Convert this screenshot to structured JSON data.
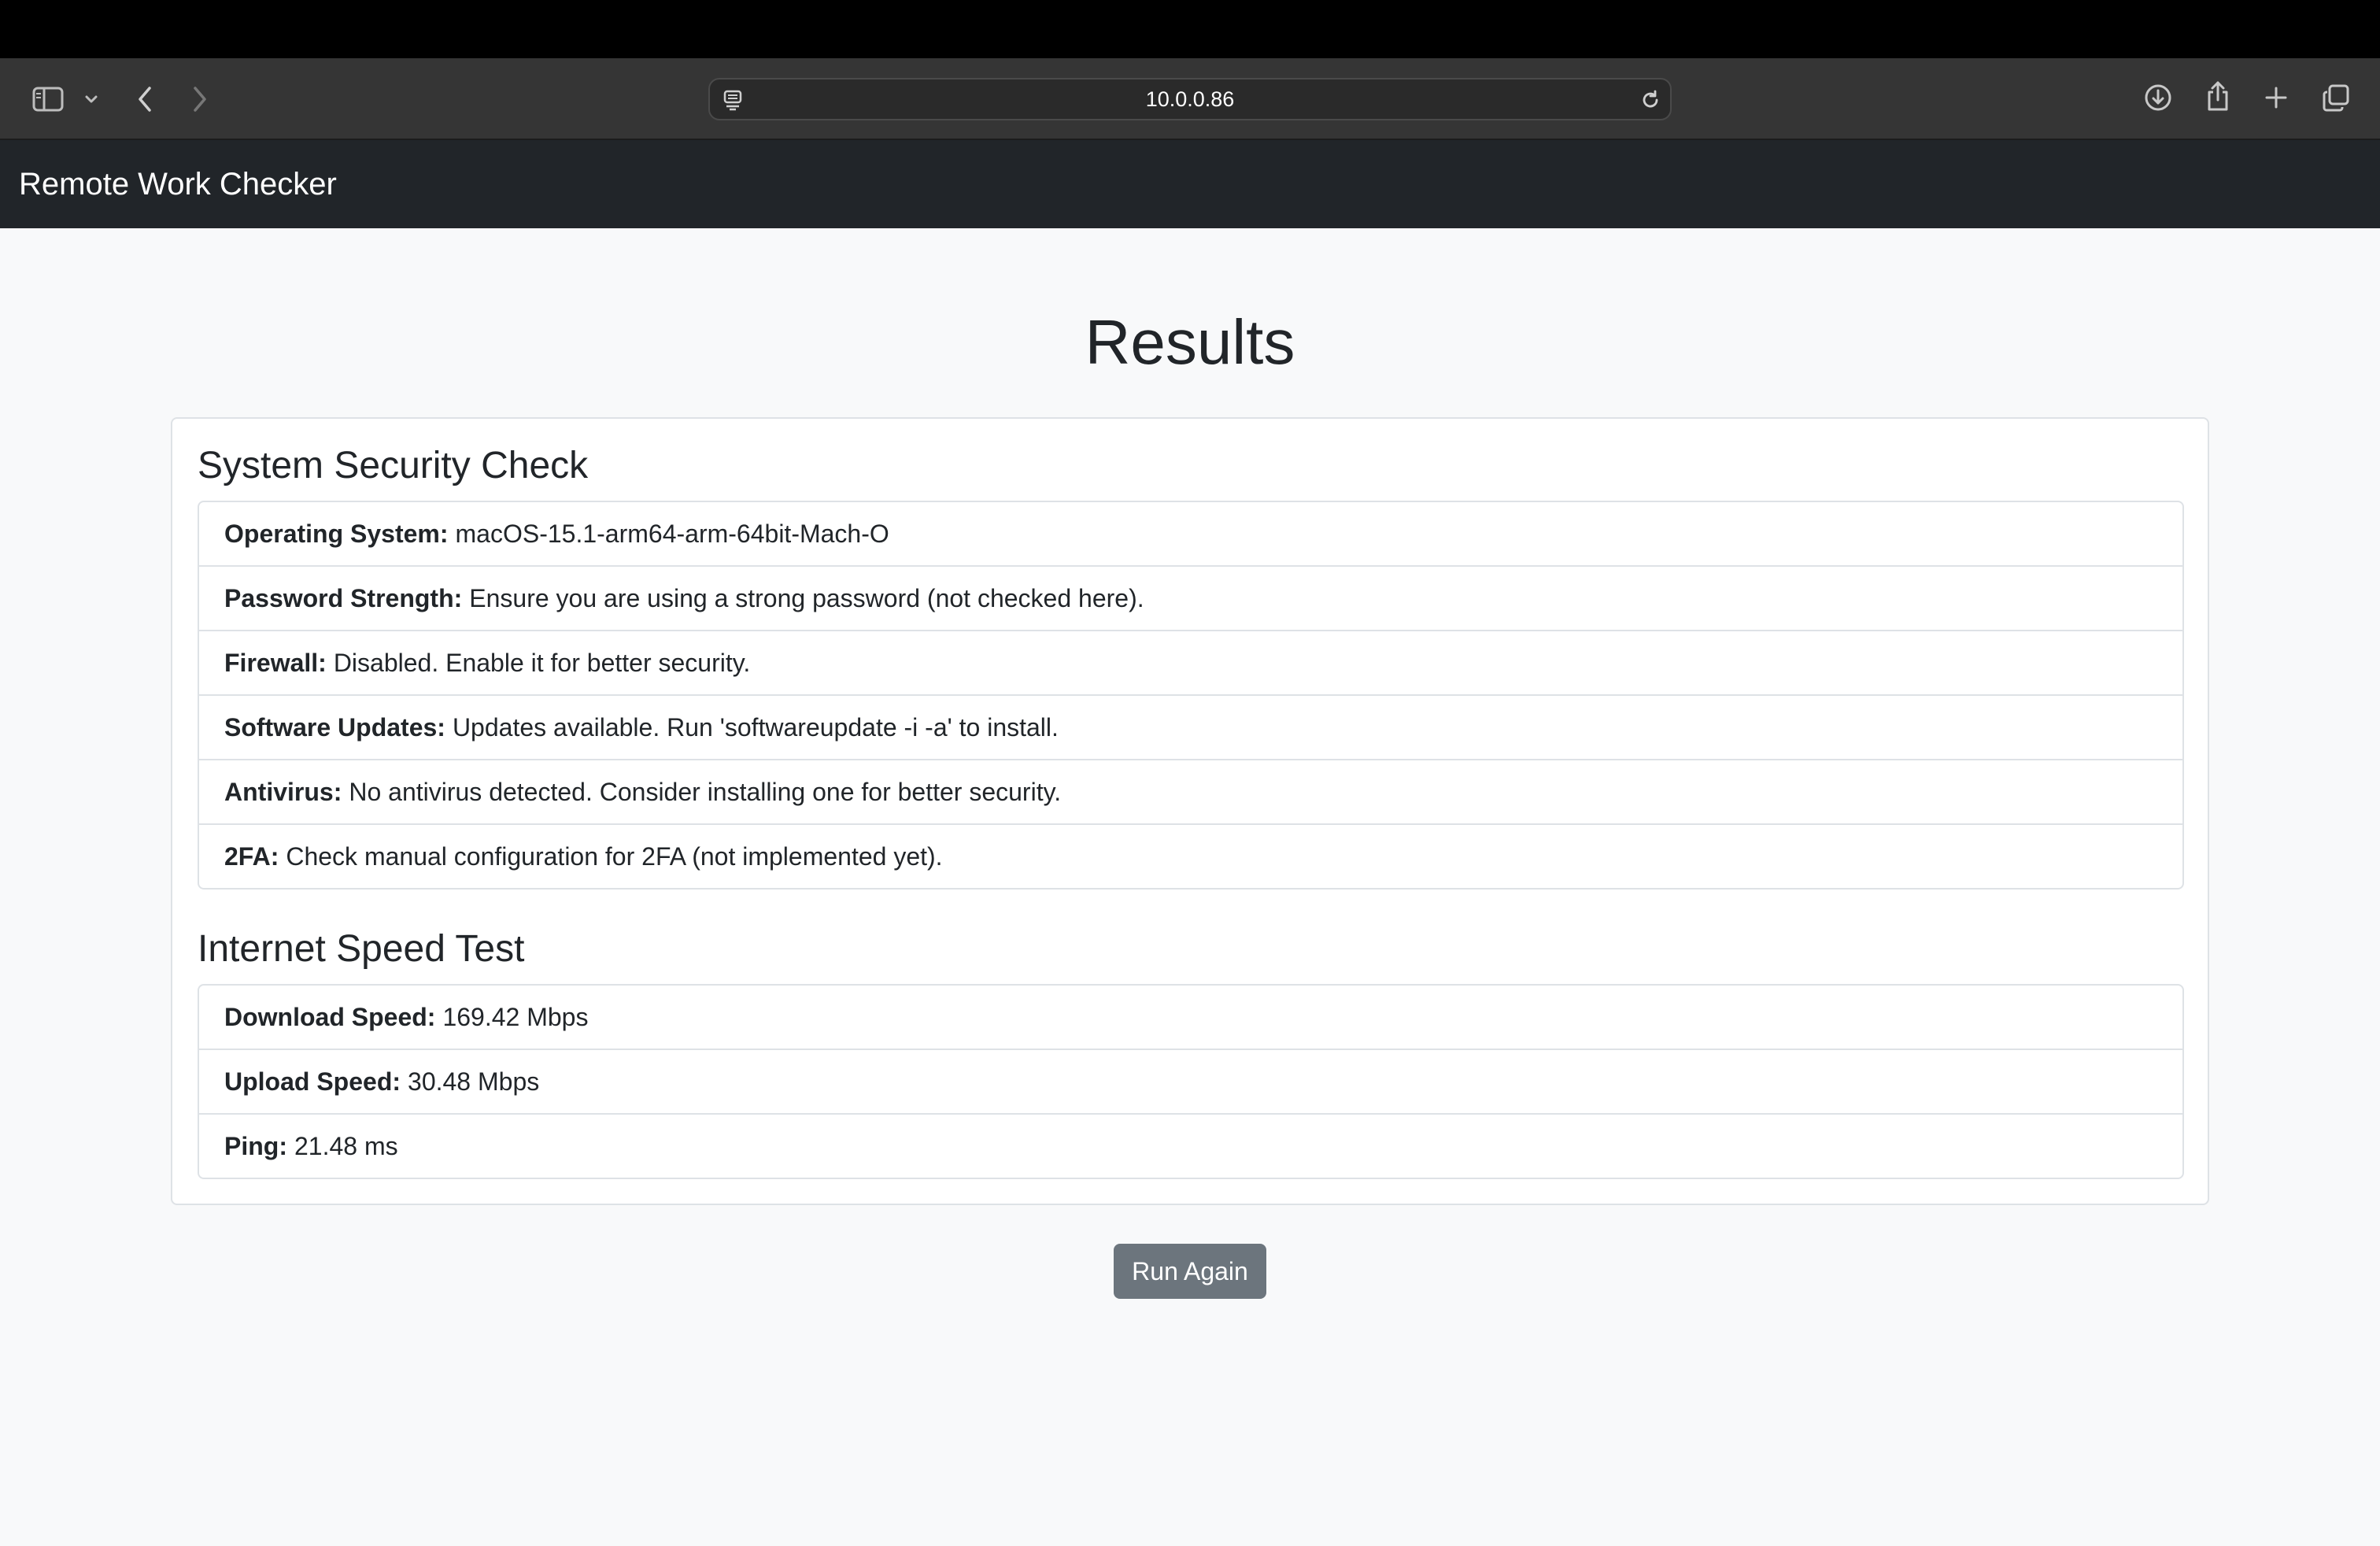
{
  "browser": {
    "url": "10.0.0.86",
    "icons": {
      "sidebar": "sidebar-icon",
      "tabs_menu": "chevron-down-icon",
      "back": "back-arrow-icon",
      "forward": "forward-arrow-icon",
      "page_settings": "page-settings-icon",
      "reload": "reload-icon",
      "downloads": "download-icon",
      "share": "share-icon",
      "new_tab": "plus-icon",
      "tab_overview": "tab-overview-icon"
    }
  },
  "navbar": {
    "brand": "Remote Work Checker"
  },
  "page": {
    "title": "Results"
  },
  "security": {
    "title": "System Security Check",
    "items": [
      {
        "label": "Operating System:",
        "value": "macOS-15.1-arm64-arm-64bit-Mach-O"
      },
      {
        "label": "Password Strength:",
        "value": "Ensure you are using a strong password (not checked here)."
      },
      {
        "label": "Firewall:",
        "value": "Disabled. Enable it for better security."
      },
      {
        "label": "Software Updates:",
        "value": "Updates available. Run 'softwareupdate -i -a' to install."
      },
      {
        "label": "Antivirus:",
        "value": "No antivirus detected. Consider installing one for better security."
      },
      {
        "label": "2FA:",
        "value": "Check manual configuration for 2FA (not implemented yet)."
      }
    ]
  },
  "speed": {
    "title": "Internet Speed Test",
    "items": [
      {
        "label": "Download Speed:",
        "value": "169.42 Mbps"
      },
      {
        "label": "Upload Speed:",
        "value": "30.48 Mbps"
      },
      {
        "label": "Ping:",
        "value": "21.48 ms"
      }
    ]
  },
  "actions": {
    "run_again": "Run Again"
  },
  "colors": {
    "navbar_bg": "#212529",
    "page_bg": "#f8f9fa",
    "button_bg": "#6c757d",
    "border": "#dee2e6"
  }
}
